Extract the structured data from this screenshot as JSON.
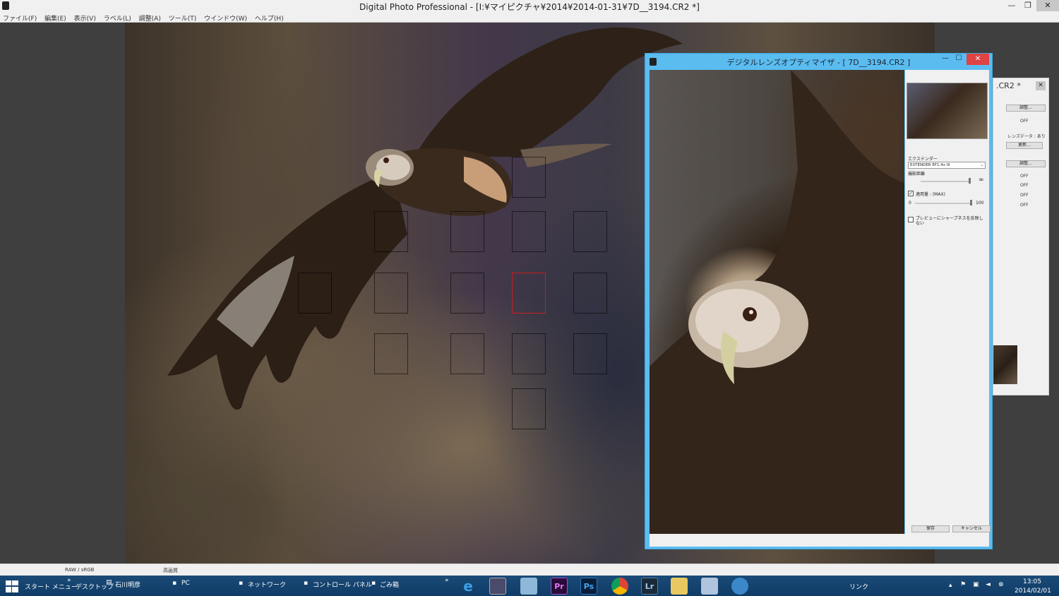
{
  "window": {
    "title": "Digital Photo Professional - [I:¥マイピクチャ¥2014¥2014-01-31¥7D__3194.CR2 *]"
  },
  "menu": [
    "ファイル(F)",
    "編集(E)",
    "表示(V)",
    "ラベル(L)",
    "調整(A)",
    "ツール(T)",
    "ウインドウ(W)",
    "ヘルプ(H)"
  ],
  "status": {
    "color_space": "RAW / sRGB",
    "quality": "高画質"
  },
  "dlo": {
    "title": "デジタルレンズオプティマイザ - [ 7D__3194.CR2 ]",
    "extender_label": "エクステンダー",
    "extender_value": "EXTENDER EF1.4x III",
    "distance_label": "撮影距離",
    "distance_infinity": "∞",
    "amount_checkbox_label": "適用量 : (MAX)",
    "amount_checked": true,
    "slider_min": "0",
    "slider_max": "100",
    "amount_level_percent": 100,
    "sharpness_checkbox_label": "プレビューにシャープネスを反映しない",
    "sharpness_checked": false,
    "save_label": "保存",
    "cancel_label": "キャンセル"
  },
  "side_panel": {
    "title": ".CR2 *",
    "adjust_label": "調整...",
    "off_1": "OFF",
    "lens_data": "レンズデータ : あり",
    "update_label": "更新...",
    "adjust2_label": "調整...",
    "off_2": "OFF",
    "off_3": "OFF",
    "off_4": "OFF",
    "off_5": "OFF"
  },
  "af_points": {
    "selected_index": 6
  },
  "taskbar": {
    "start": "スタート メニュー",
    "desktop": "デスクトップ",
    "user_folder": "石川明彦",
    "pc": "PC",
    "network": "ネットワーク",
    "control_panel": "コントロール パネル",
    "trash": "ごみ箱",
    "links": "リンク",
    "time": "13:05",
    "date": "2014/02/01",
    "apps": [
      "e",
      "",
      "",
      "Pr",
      "Ps",
      "",
      "Lr",
      "",
      "",
      ""
    ]
  },
  "colors": {
    "dlo_frame": "#5bbcf0",
    "close_red": "#e04343",
    "af_selected": "#c81e1e"
  }
}
